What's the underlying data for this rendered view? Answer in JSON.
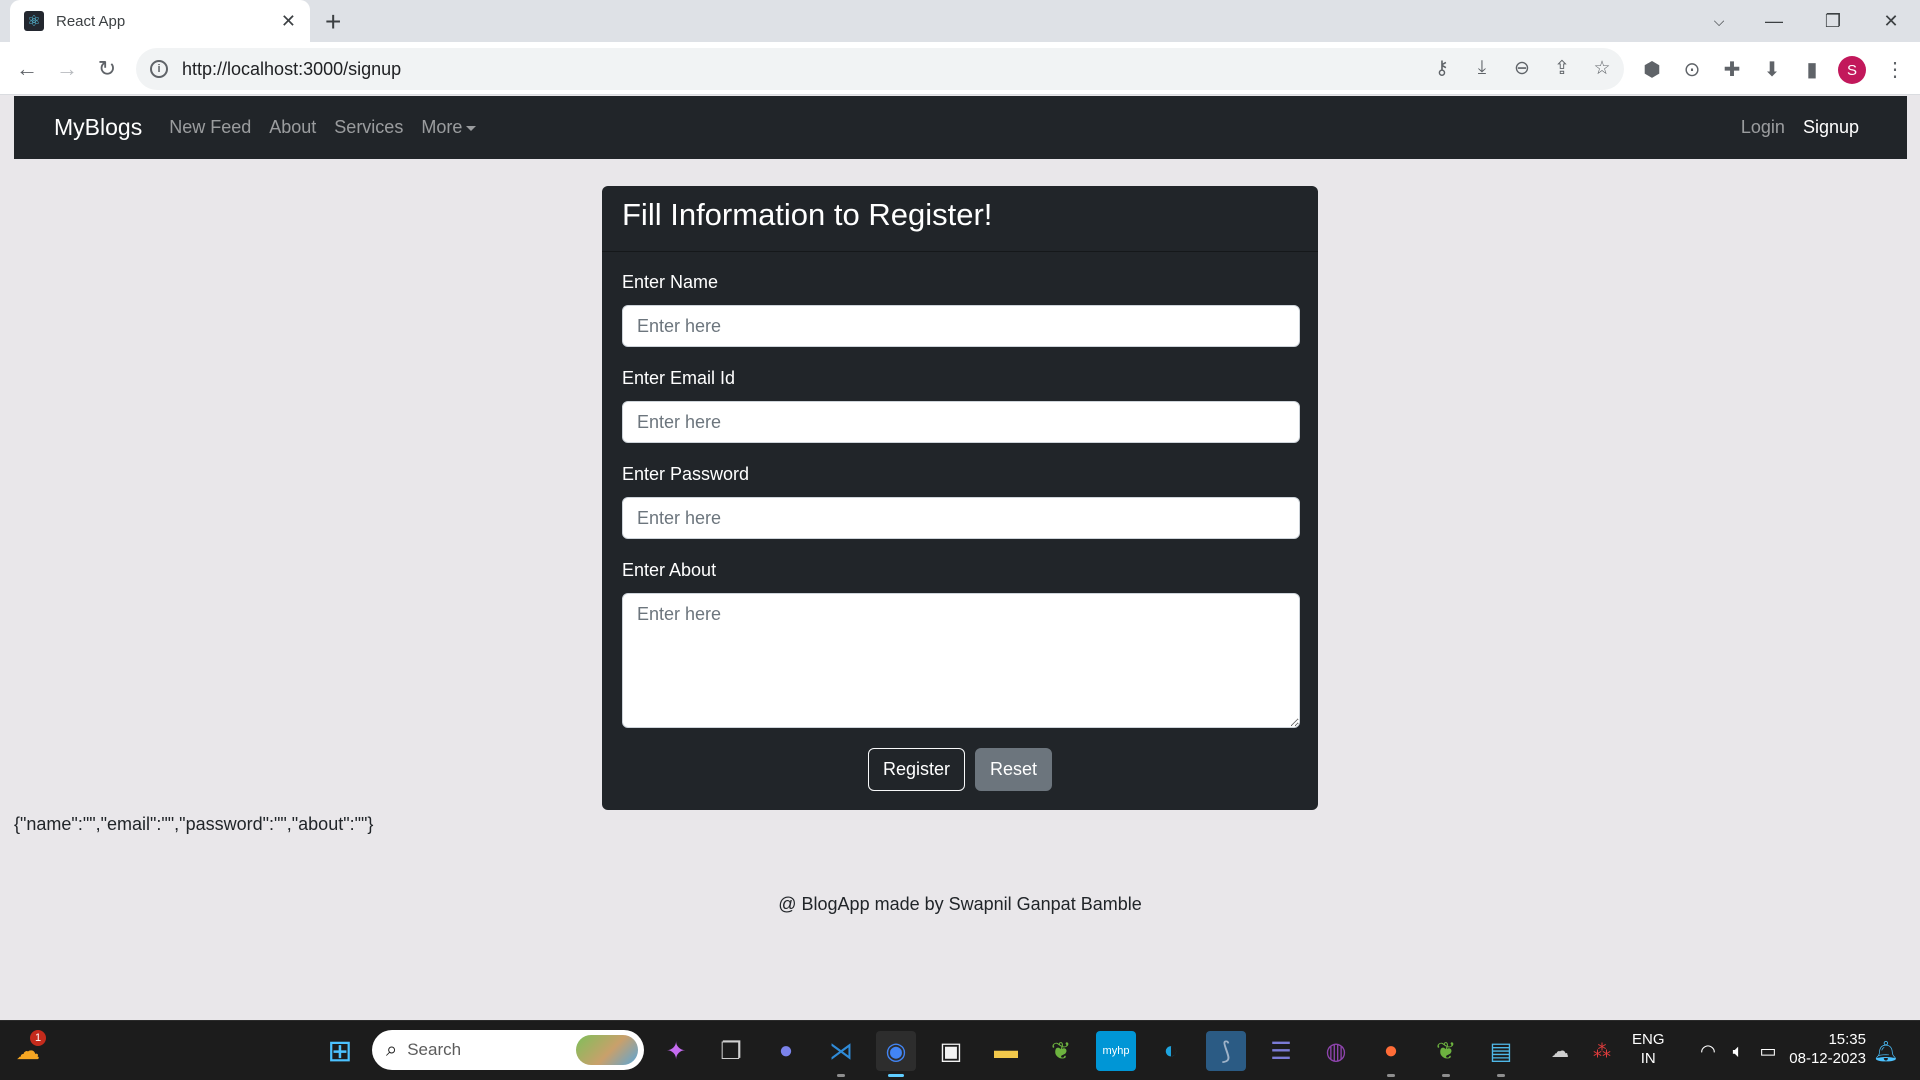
{
  "browser": {
    "tab_title": "React App",
    "url": "http://localhost:3000/signup",
    "profile_initial": "S",
    "toolbar_icons": [
      "key-icon",
      "install-app-icon",
      "zoom-out-icon",
      "share-icon",
      "bookmark-star-icon",
      "extension-cube-icon",
      "extension-code-icon",
      "extensions-puzzle-icon",
      "downloads-icon",
      "side-panel-icon",
      "menu-kebab-icon"
    ]
  },
  "navbar": {
    "brand": "MyBlogs",
    "links": [
      {
        "label": "New Feed"
      },
      {
        "label": "About"
      },
      {
        "label": "Services"
      },
      {
        "label": "More"
      }
    ],
    "right_links": [
      {
        "label": "Login",
        "active": false
      },
      {
        "label": "Signup",
        "active": true
      }
    ]
  },
  "form": {
    "title": "Fill Information to Register!",
    "fields": [
      {
        "label": "Enter Name",
        "placeholder": "Enter here",
        "value": "",
        "type": "text"
      },
      {
        "label": "Enter Email Id",
        "placeholder": "Enter here",
        "value": "",
        "type": "email"
      },
      {
        "label": "Enter Password",
        "placeholder": "Enter here",
        "value": "",
        "type": "password"
      },
      {
        "label": "Enter About",
        "placeholder": "Enter here",
        "value": "",
        "type": "textarea"
      }
    ],
    "register_label": "Register",
    "reset_label": "Reset"
  },
  "debug_json": "{\"name\":\"\",\"email\":\"\",\"password\":\"\",\"about\":\"\"}",
  "footer": "@ BlogApp made by Swapnil Ganpat Bamble",
  "taskbar": {
    "weather_badge": "1",
    "search_placeholder": "Search",
    "apps": [
      "copilot-preview",
      "task-view",
      "teams-chat",
      "vs-code",
      "chrome",
      "microsoft-store",
      "file-explorer",
      "spring-tools",
      "myhp",
      "edge",
      "mysql-workbench",
      "eclipse",
      "github-desktop",
      "postman",
      "spring-tools-2",
      "notepad"
    ],
    "language": "ENG",
    "region": "IN",
    "time": "15:35",
    "date": "08-12-2023"
  },
  "colors": {
    "navbar_bg": "#212529",
    "page_bg": "#e9e7ea",
    "secondary_btn": "#6c757d",
    "profile": "#c2185b"
  }
}
